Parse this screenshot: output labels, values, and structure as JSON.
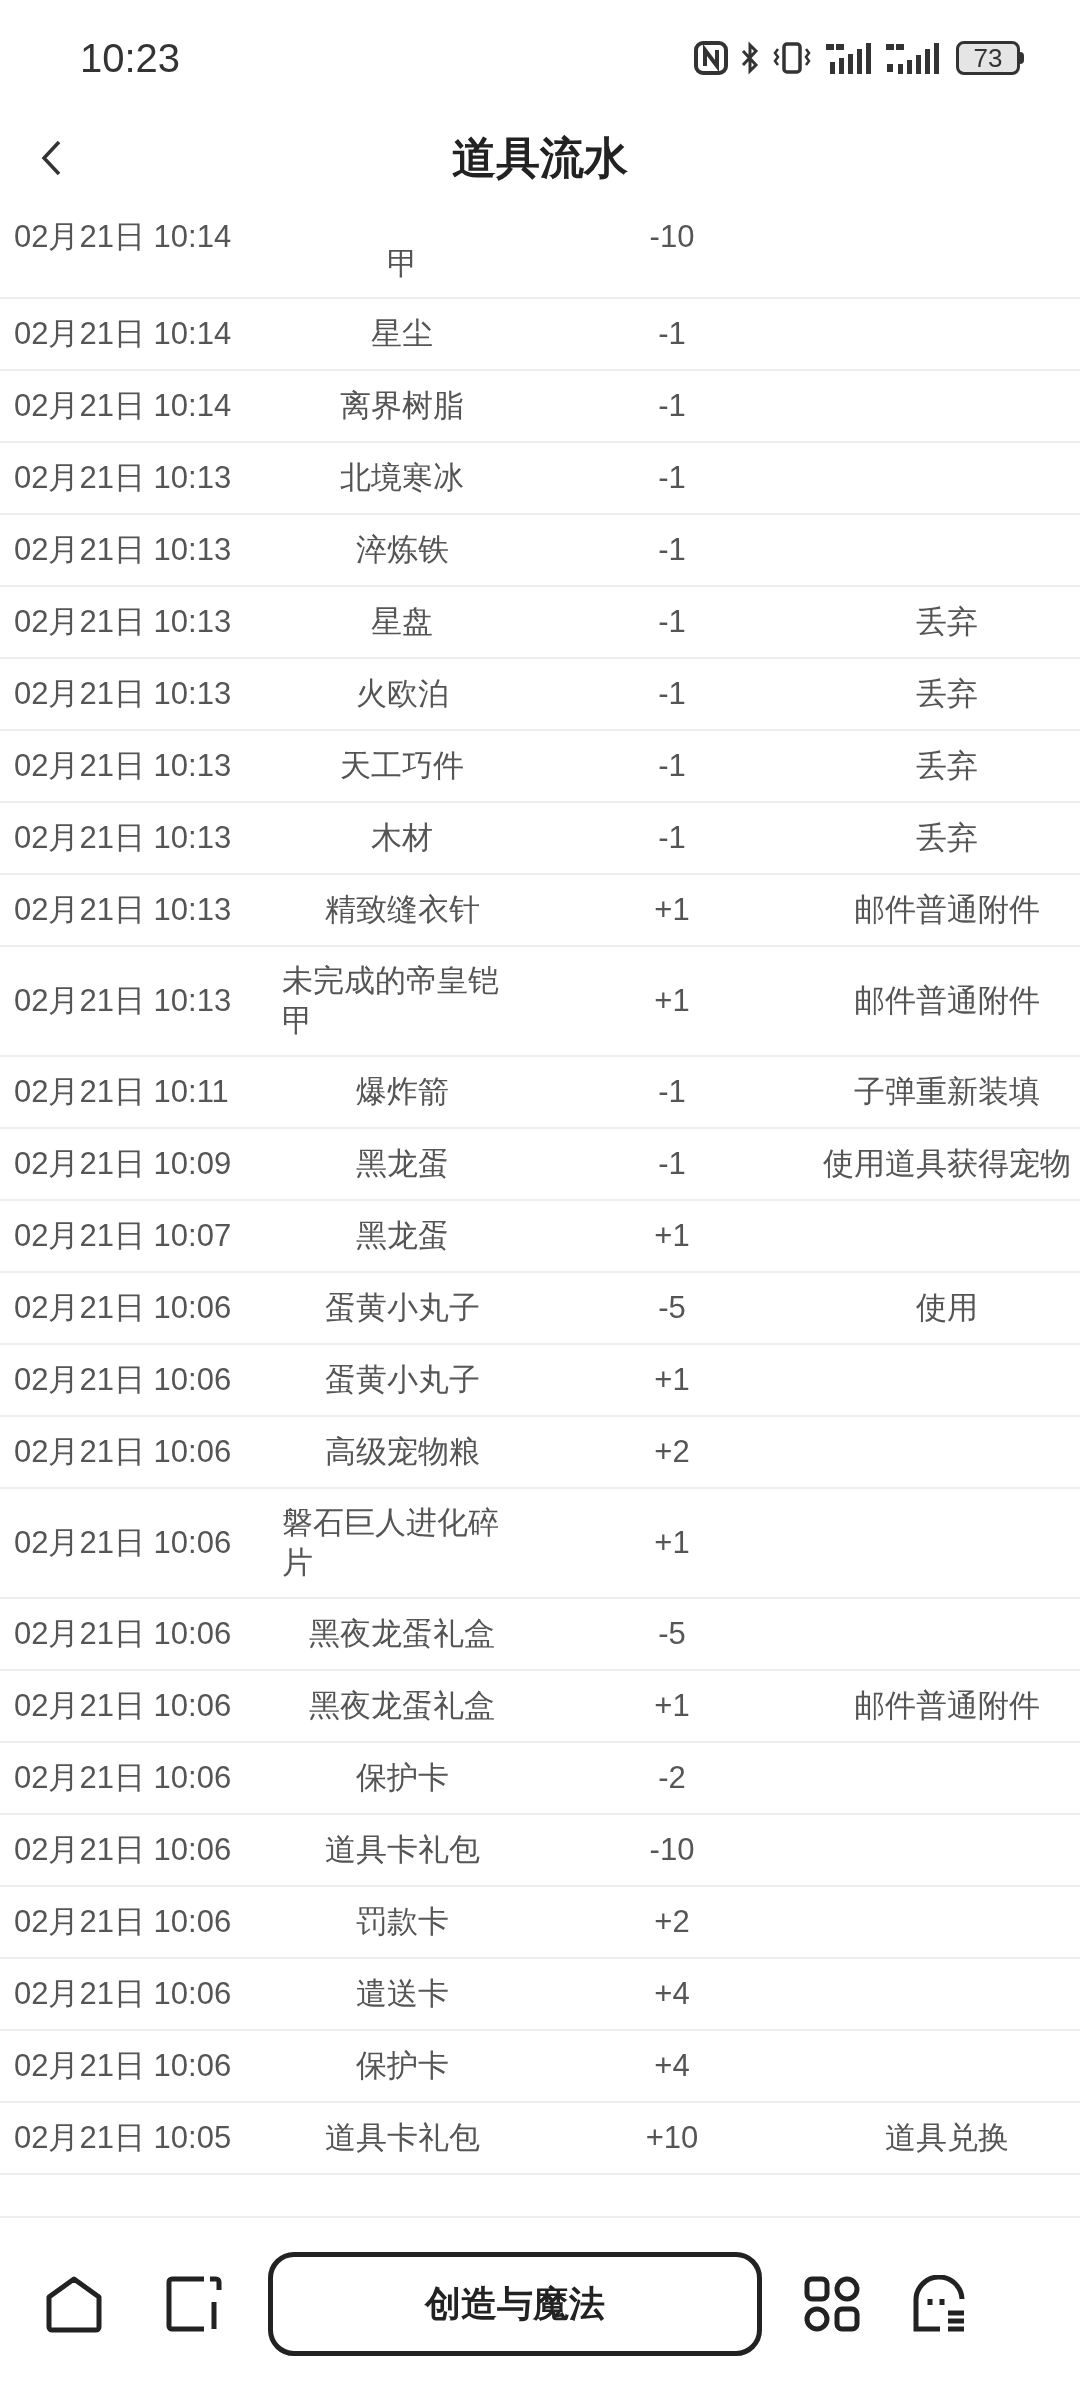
{
  "status_bar": {
    "time": "10:23",
    "battery": "73"
  },
  "header": {
    "title": "道具流水"
  },
  "records": [
    {
      "kind": "clipped",
      "time": "02月21日 10:14",
      "item": "甲",
      "amount": "-10"
    },
    {
      "kind": "full",
      "time": "02月21日 10:14",
      "item": "星尘",
      "amount": "-1"
    },
    {
      "kind": "full",
      "time": "02月21日 10:14",
      "item": "离界树脂",
      "amount": "-1"
    },
    {
      "kind": "full",
      "time": "02月21日 10:13",
      "item": "北境寒冰",
      "amount": "-1"
    },
    {
      "kind": "full",
      "time": "02月21日 10:13",
      "item": "淬炼铁",
      "amount": "-1"
    },
    {
      "kind": "full",
      "time": "02月21日 10:13",
      "item": "星盘",
      "amount": "-1",
      "note": "丢弃"
    },
    {
      "kind": "full",
      "time": "02月21日 10:13",
      "item": "火欧泊",
      "amount": "-1",
      "note": "丢弃"
    },
    {
      "kind": "full",
      "time": "02月21日 10:13",
      "item": "天工巧件",
      "amount": "-1",
      "note": "丢弃"
    },
    {
      "kind": "full",
      "time": "02月21日 10:13",
      "item": "木材",
      "amount": "-1",
      "note": "丢弃"
    },
    {
      "kind": "full",
      "time": "02月21日 10:13",
      "item": "精致缝衣针",
      "amount": "+1",
      "note": "邮件普通附件"
    },
    {
      "kind": "full",
      "time": "02月21日 10:13",
      "item": "未完成的帝皇铠甲",
      "amount": "+1",
      "note": "邮件普通附件"
    },
    {
      "kind": "full",
      "time": "02月21日 10:11",
      "item": "爆炸箭",
      "amount": "-1",
      "note": "子弹重新装填"
    },
    {
      "kind": "full",
      "time": "02月21日 10:09",
      "item": "黑龙蛋",
      "amount": "-1",
      "note": "使用道具获得宠物"
    },
    {
      "kind": "full",
      "time": "02月21日 10:07",
      "item": "黑龙蛋",
      "amount": "+1"
    },
    {
      "kind": "full",
      "time": "02月21日 10:06",
      "item": "蛋黄小丸子",
      "amount": "-5",
      "note": "使用"
    },
    {
      "kind": "full",
      "time": "02月21日 10:06",
      "item": "蛋黄小丸子",
      "amount": "+1"
    },
    {
      "kind": "full",
      "time": "02月21日 10:06",
      "item": "高级宠物粮",
      "amount": "+2"
    },
    {
      "kind": "full",
      "time": "02月21日 10:06",
      "item": "磐石巨人进化碎片",
      "amount": "+1"
    },
    {
      "kind": "full",
      "time": "02月21日 10:06",
      "item": "黑夜龙蛋礼盒",
      "amount": "-5"
    },
    {
      "kind": "full",
      "time": "02月21日 10:06",
      "item": "黑夜龙蛋礼盒",
      "amount": "+1",
      "note": "邮件普通附件"
    },
    {
      "kind": "full",
      "time": "02月21日 10:06",
      "item": "保护卡",
      "amount": "-2"
    },
    {
      "kind": "full",
      "time": "02月21日 10:06",
      "item": "道具卡礼包",
      "amount": "-10"
    },
    {
      "kind": "full",
      "time": "02月21日 10:06",
      "item": "罚款卡",
      "amount": "+2"
    },
    {
      "kind": "full",
      "time": "02月21日 10:06",
      "item": "遣送卡",
      "amount": "+4"
    },
    {
      "kind": "full",
      "time": "02月21日 10:06",
      "item": "保护卡",
      "amount": "+4"
    },
    {
      "kind": "full",
      "time": "02月21日 10:05",
      "item": "道具卡礼包",
      "amount": "+10",
      "note": "道具兑换"
    }
  ],
  "bottom_nav": {
    "center_button": "创造与魔法"
  }
}
